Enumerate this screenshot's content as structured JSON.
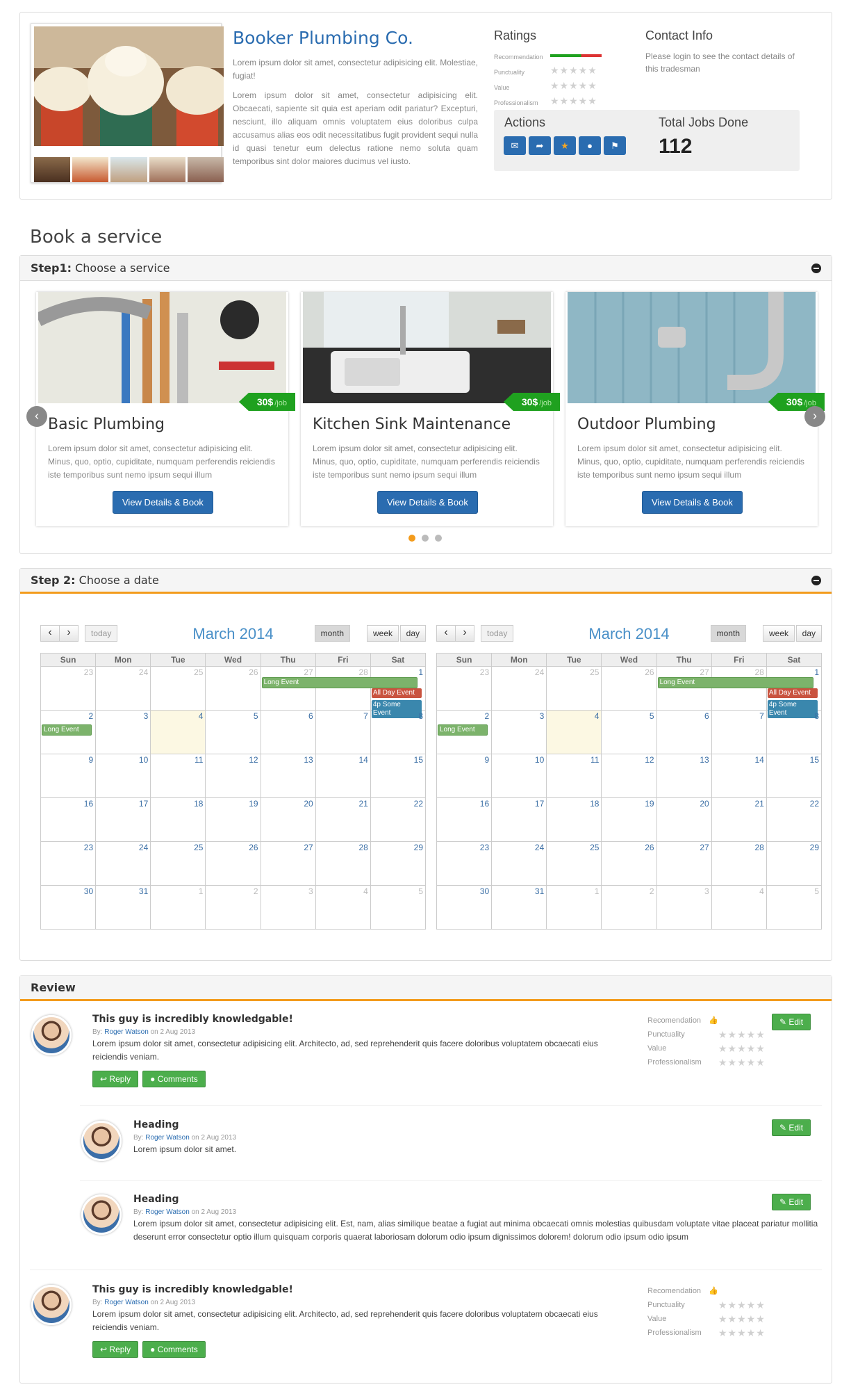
{
  "profile": {
    "name": "Booker Plumbing Co.",
    "tagline": "Lorem ipsum dolor sit amet, consectetur adipisicing elit. Molestiae, fugiat!",
    "description": "Lorem ipsum dolor sit amet, consectetur adipisicing elit. Obcaecati, sapiente sit quia est aperiam odit pariatur? Excepturi, nesciunt, illo aliquam omnis voluptatem eius doloribus culpa accusamus alias eos odit necessitatibus fugit provident sequi nulla id quasi tenetur eum delectus ratione nemo soluta quam temporibus sint dolor maiores ducimus vel iusto.",
    "ratings_title": "Ratings",
    "rating_labels": [
      "Recommendation",
      "Punctuality",
      "Value",
      "Professionalism"
    ],
    "contact_title": "Contact Info",
    "contact_text": "Please login to see the contact details of this tradesman",
    "actions_title": "Actions",
    "jobs_title": "Total Jobs Done",
    "jobs_count": "112",
    "action_icons": [
      "envelope-icon",
      "share-icon",
      "star-icon",
      "comment-icon",
      "flag-icon"
    ]
  },
  "book": {
    "heading": "Book a service",
    "step1_bold": "Step1:",
    "step1_text": "Choose a service",
    "step2_bold": "Step 2:",
    "step2_text": "Choose a date"
  },
  "services": [
    {
      "title": "Basic Plumbing",
      "price": "30$",
      "unit": "/job",
      "desc": "Lorem ipsum dolor sit amet, consectetur adipisicing elit. Minus, quo, optio, cupiditate, numquam perferendis reiciendis iste temporibus sunt nemo ipsum sequi illum",
      "button": "View Details & Book"
    },
    {
      "title": "Kitchen Sink Maintenance",
      "price": "30$",
      "unit": "/job",
      "desc": "Lorem ipsum dolor sit amet, consectetur adipisicing elit. Minus, quo, optio, cupiditate, numquam perferendis reiciendis iste temporibus sunt nemo ipsum sequi illum",
      "button": "View Details & Book"
    },
    {
      "title": "Outdoor Plumbing",
      "price": "30$",
      "unit": "/job",
      "desc": "Lorem ipsum dolor sit amet, consectetur adipisicing elit. Minus, quo, optio, cupiditate, numquam perferendis reiciendis iste temporibus sunt nemo ipsum sequi illum",
      "button": "View Details & Book"
    }
  ],
  "calendar": {
    "title": "March 2014",
    "today": "today",
    "views": [
      "month",
      "week",
      "day"
    ],
    "active_view": "month",
    "weekdays": [
      "Sun",
      "Mon",
      "Tue",
      "Wed",
      "Thu",
      "Fri",
      "Sat"
    ],
    "weeks": [
      [
        "23",
        "24",
        "25",
        "26",
        "27",
        "28",
        "1"
      ],
      [
        "2",
        "3",
        "4",
        "5",
        "6",
        "7",
        "8"
      ],
      [
        "9",
        "10",
        "11",
        "12",
        "13",
        "14",
        "15"
      ],
      [
        "16",
        "17",
        "18",
        "19",
        "20",
        "21",
        "22"
      ],
      [
        "23",
        "24",
        "25",
        "26",
        "27",
        "28",
        "29"
      ],
      [
        "30",
        "31",
        "1",
        "2",
        "3",
        "4",
        "5"
      ]
    ],
    "events": {
      "long": "Long Event",
      "allday": "All Day Event",
      "some": "4p Some Event"
    }
  },
  "review": {
    "title": "Review",
    "by_label": "By:",
    "rating_labels": [
      "Recomendation",
      "Punctuality",
      "Value",
      "Professionalism"
    ],
    "edit": "Edit",
    "reply": "Reply",
    "comments": "Comments",
    "items": [
      {
        "title": "This guy is incredibly knowledgable!",
        "author": "Roger Watson",
        "date": "on 2 Aug 2013",
        "text": "Lorem ipsum dolor sit amet, consectetur adipisicing elit. Architecto, ad, sed reprehenderit quis facere doloribus voluptatem obcaecati eius reiciendis veniam."
      },
      {
        "title": "Heading",
        "author": "Roger Watson",
        "date": "on 2 Aug 2013",
        "text": "Lorem ipsum dolor sit amet."
      },
      {
        "title": "Heading",
        "author": "Roger Watson",
        "date": "on 2 Aug 2013",
        "text": "Lorem ipsum dolor sit amet, consectetur adipisicing elit. Est, nam, alias similique beatae a fugiat aut minima obcaecati omnis molestias quibusdam voluptate vitae placeat pariatur mollitia deserunt error consectetur optio illum quisquam corporis quaerat laboriosam dolorum odio ipsum dignissimos dolorem! dolorum odio ipsum odio ipsum"
      },
      {
        "title": "This guy is incredibly knowledgable!",
        "author": "Roger Watson",
        "date": "on 2 Aug 2013",
        "text": "Lorem ipsum dolor sit amet, consectetur adipisicing elit. Architecto, ad, sed reprehenderit quis facere doloribus voluptatem obcaecati eius reiciendis veniam."
      }
    ]
  }
}
